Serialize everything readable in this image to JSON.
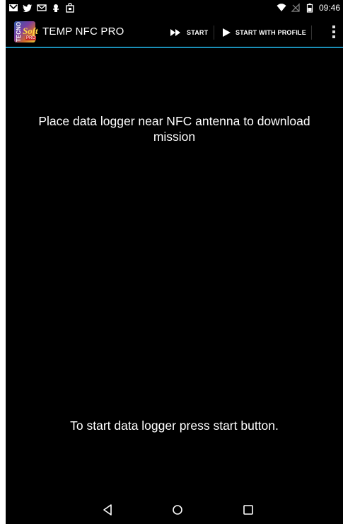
{
  "status_bar": {
    "time": "09:46",
    "left_icons": [
      "gmail-icon",
      "twitter-icon",
      "mail-icon",
      "android-debug-icon",
      "store-icon"
    ],
    "right_icons": [
      "wifi-icon",
      "no-signal-icon",
      "battery-icon"
    ]
  },
  "action_bar": {
    "title": "TEMP NFC PRO",
    "start_label": "START",
    "start_with_profile_label": "START WITH PROFILE",
    "accent_color": "#1a8fb8"
  },
  "main": {
    "nfc_message": "Place data logger near NFC antenna to download mission",
    "start_message": "To start data logger press start button."
  },
  "nav_bar": {
    "buttons": [
      "back-icon",
      "home-icon",
      "recents-icon"
    ]
  }
}
